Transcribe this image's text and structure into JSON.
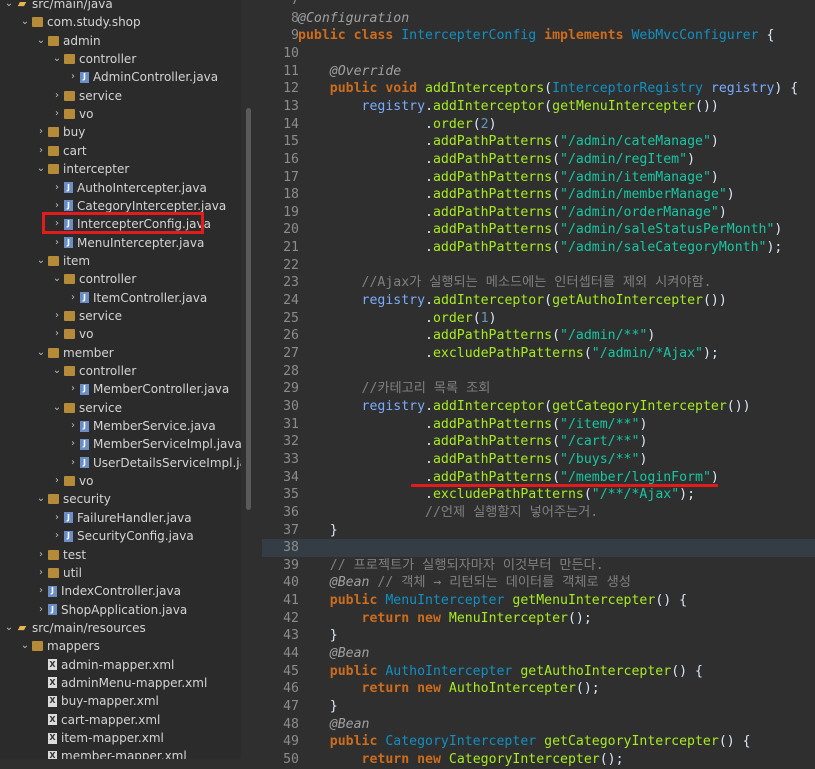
{
  "explorer": {
    "items": [
      {
        "label": "src/main/java",
        "icon": "source-folder-icon",
        "indent": 0,
        "arrow": "v"
      },
      {
        "label": "com.study.shop",
        "icon": "package-icon",
        "indent": 1,
        "arrow": "v"
      },
      {
        "label": "admin",
        "icon": "package-icon",
        "indent": 2,
        "arrow": "v"
      },
      {
        "label": "controller",
        "icon": "package-icon",
        "indent": 3,
        "arrow": "v"
      },
      {
        "label": "AdminController.java",
        "icon": "java-file-icon",
        "indent": 4,
        "arrow": ">"
      },
      {
        "label": "service",
        "icon": "package-icon",
        "indent": 3,
        "arrow": ">"
      },
      {
        "label": "vo",
        "icon": "package-icon",
        "indent": 3,
        "arrow": ">"
      },
      {
        "label": "buy",
        "icon": "package-icon",
        "indent": 2,
        "arrow": ">"
      },
      {
        "label": "cart",
        "icon": "package-icon",
        "indent": 2,
        "arrow": ">"
      },
      {
        "label": "intercepter",
        "icon": "package-icon",
        "indent": 2,
        "arrow": "v"
      },
      {
        "label": "AuthoIntercepter.java",
        "icon": "java-file-icon",
        "indent": 3,
        "arrow": ">"
      },
      {
        "label": "CategoryIntercepter.java",
        "icon": "java-file-icon",
        "indent": 3,
        "arrow": ">"
      },
      {
        "label": "IntercepterConfig.java",
        "icon": "java-file-icon",
        "indent": 3,
        "arrow": ">"
      },
      {
        "label": "MenuIntercepter.java",
        "icon": "java-file-icon",
        "indent": 3,
        "arrow": ">"
      },
      {
        "label": "item",
        "icon": "package-icon",
        "indent": 2,
        "arrow": "v"
      },
      {
        "label": "controller",
        "icon": "package-icon",
        "indent": 3,
        "arrow": "v"
      },
      {
        "label": "ItemController.java",
        "icon": "java-file-icon",
        "indent": 4,
        "arrow": ">"
      },
      {
        "label": "service",
        "icon": "package-icon",
        "indent": 3,
        "arrow": ">"
      },
      {
        "label": "vo",
        "icon": "package-icon",
        "indent": 3,
        "arrow": ">"
      },
      {
        "label": "member",
        "icon": "package-icon",
        "indent": 2,
        "arrow": "v"
      },
      {
        "label": "controller",
        "icon": "package-icon",
        "indent": 3,
        "arrow": "v"
      },
      {
        "label": "MemberController.java",
        "icon": "java-file-icon",
        "indent": 4,
        "arrow": ">"
      },
      {
        "label": "service",
        "icon": "package-icon",
        "indent": 3,
        "arrow": "v"
      },
      {
        "label": "MemberService.java",
        "icon": "java-file-icon",
        "indent": 4,
        "arrow": ">"
      },
      {
        "label": "MemberServiceImpl.java",
        "icon": "java-file-icon",
        "indent": 4,
        "arrow": ">"
      },
      {
        "label": "UserDetailsServiceImpl.java",
        "icon": "java-file-icon",
        "indent": 4,
        "arrow": ">"
      },
      {
        "label": "vo",
        "icon": "package-icon",
        "indent": 3,
        "arrow": ">"
      },
      {
        "label": "security",
        "icon": "package-icon",
        "indent": 2,
        "arrow": "v"
      },
      {
        "label": "FailureHandler.java",
        "icon": "java-file-icon",
        "indent": 3,
        "arrow": ">"
      },
      {
        "label": "SecurityConfig.java",
        "icon": "java-file-icon",
        "indent": 3,
        "arrow": ">"
      },
      {
        "label": "test",
        "icon": "package-icon",
        "indent": 2,
        "arrow": ">"
      },
      {
        "label": "util",
        "icon": "package-icon",
        "indent": 2,
        "arrow": ">"
      },
      {
        "label": "IndexController.java",
        "icon": "java-file-icon",
        "indent": 2,
        "arrow": ">"
      },
      {
        "label": "ShopApplication.java",
        "icon": "java-file-icon",
        "indent": 2,
        "arrow": ">"
      },
      {
        "label": "src/main/resources",
        "icon": "source-folder-icon",
        "indent": 0,
        "arrow": "v"
      },
      {
        "label": "mappers",
        "icon": "package-icon",
        "indent": 1,
        "arrow": "v"
      },
      {
        "label": "admin-mapper.xml",
        "icon": "xml-file-icon",
        "indent": 2,
        "arrow": ""
      },
      {
        "label": "adminMenu-mapper.xml",
        "icon": "xml-file-icon",
        "indent": 2,
        "arrow": ""
      },
      {
        "label": "buy-mapper.xml",
        "icon": "xml-file-icon",
        "indent": 2,
        "arrow": ""
      },
      {
        "label": "cart-mapper.xml",
        "icon": "xml-file-icon",
        "indent": 2,
        "arrow": ""
      },
      {
        "label": "item-mapper.xml",
        "icon": "xml-file-icon",
        "indent": 2,
        "arrow": ""
      },
      {
        "label": "member-mapper.xml",
        "icon": "xml-file-icon",
        "indent": 2,
        "arrow": ""
      }
    ]
  },
  "editor": {
    "lines": [
      {
        "n": "7",
        "tokens": []
      },
      {
        "n": "8",
        "tokens": [
          [
            "ann",
            "@Configuration"
          ]
        ]
      },
      {
        "n": "9",
        "tokens": [
          [
            "kw",
            "public class "
          ],
          [
            "type",
            "IntercepterConfig "
          ],
          [
            "kw",
            "implements "
          ],
          [
            "type",
            "WebMvcConfigurer "
          ],
          [
            "plain",
            "{"
          ]
        ]
      },
      {
        "n": "10",
        "tokens": []
      },
      {
        "n": "11",
        "tokens": [
          [
            "plain",
            "    "
          ],
          [
            "ann",
            "@Override"
          ]
        ]
      },
      {
        "n": "12",
        "tokens": [
          [
            "plain",
            "    "
          ],
          [
            "kw",
            "public void "
          ],
          [
            "meth",
            "addInterceptors"
          ],
          [
            "plain",
            "("
          ],
          [
            "type",
            "InterceptorRegistry "
          ],
          [
            "var",
            "registry"
          ],
          [
            "plain",
            ") {"
          ]
        ]
      },
      {
        "n": "13",
        "tokens": [
          [
            "plain",
            "        "
          ],
          [
            "var",
            "registry"
          ],
          [
            "plain",
            "."
          ],
          [
            "meth",
            "addInterceptor"
          ],
          [
            "plain",
            "("
          ],
          [
            "meth",
            "getMenuIntercepter"
          ],
          [
            "plain",
            "())"
          ]
        ]
      },
      {
        "n": "14",
        "tokens": [
          [
            "plain",
            "                ."
          ],
          [
            "meth",
            "order"
          ],
          [
            "plain",
            "("
          ],
          [
            "num",
            "2"
          ],
          [
            "plain",
            ")"
          ]
        ]
      },
      {
        "n": "15",
        "tokens": [
          [
            "plain",
            "                ."
          ],
          [
            "meth",
            "addPathPatterns"
          ],
          [
            "plain",
            "("
          ],
          [
            "str",
            "\"/admin/cateManage\""
          ],
          [
            "plain",
            ")"
          ]
        ]
      },
      {
        "n": "16",
        "tokens": [
          [
            "plain",
            "                ."
          ],
          [
            "meth",
            "addPathPatterns"
          ],
          [
            "plain",
            "("
          ],
          [
            "str",
            "\"/admin/regItem\""
          ],
          [
            "plain",
            ")"
          ]
        ]
      },
      {
        "n": "17",
        "tokens": [
          [
            "plain",
            "                ."
          ],
          [
            "meth",
            "addPathPatterns"
          ],
          [
            "plain",
            "("
          ],
          [
            "str",
            "\"/admin/itemManage\""
          ],
          [
            "plain",
            ")"
          ]
        ]
      },
      {
        "n": "18",
        "tokens": [
          [
            "plain",
            "                ."
          ],
          [
            "meth",
            "addPathPatterns"
          ],
          [
            "plain",
            "("
          ],
          [
            "str",
            "\"/admin/memberManage\""
          ],
          [
            "plain",
            ")"
          ]
        ]
      },
      {
        "n": "19",
        "tokens": [
          [
            "plain",
            "                ."
          ],
          [
            "meth",
            "addPathPatterns"
          ],
          [
            "plain",
            "("
          ],
          [
            "str",
            "\"/admin/orderManage\""
          ],
          [
            "plain",
            ")"
          ]
        ]
      },
      {
        "n": "20",
        "tokens": [
          [
            "plain",
            "                ."
          ],
          [
            "meth",
            "addPathPatterns"
          ],
          [
            "plain",
            "("
          ],
          [
            "str",
            "\"/admin/saleStatusPerMonth\""
          ],
          [
            "plain",
            ")"
          ]
        ]
      },
      {
        "n": "21",
        "tokens": [
          [
            "plain",
            "                ."
          ],
          [
            "meth",
            "addPathPatterns"
          ],
          [
            "plain",
            "("
          ],
          [
            "str",
            "\"/admin/saleCategoryMonth\""
          ],
          [
            "plain",
            ");"
          ]
        ]
      },
      {
        "n": "22",
        "tokens": []
      },
      {
        "n": "23",
        "tokens": [
          [
            "plain",
            "        "
          ],
          [
            "cmt",
            "//Ajax가 실행되는 메소드에는 인터셉터를 제외 시켜야함."
          ]
        ]
      },
      {
        "n": "24",
        "tokens": [
          [
            "plain",
            "        "
          ],
          [
            "var",
            "registry"
          ],
          [
            "plain",
            "."
          ],
          [
            "meth",
            "addInterceptor"
          ],
          [
            "plain",
            "("
          ],
          [
            "meth",
            "getAuthoIntercepter"
          ],
          [
            "plain",
            "())"
          ]
        ]
      },
      {
        "n": "25",
        "tokens": [
          [
            "plain",
            "                ."
          ],
          [
            "meth",
            "order"
          ],
          [
            "plain",
            "("
          ],
          [
            "num",
            "1"
          ],
          [
            "plain",
            ")"
          ]
        ]
      },
      {
        "n": "26",
        "tokens": [
          [
            "plain",
            "                ."
          ],
          [
            "meth",
            "addPathPatterns"
          ],
          [
            "plain",
            "("
          ],
          [
            "str",
            "\"/admin/**\""
          ],
          [
            "plain",
            ")"
          ]
        ]
      },
      {
        "n": "27",
        "tokens": [
          [
            "plain",
            "                ."
          ],
          [
            "meth",
            "excludePathPatterns"
          ],
          [
            "plain",
            "("
          ],
          [
            "str",
            "\"/admin/*Ajax\""
          ],
          [
            "plain",
            ");"
          ]
        ]
      },
      {
        "n": "28",
        "tokens": []
      },
      {
        "n": "29",
        "tokens": [
          [
            "plain",
            "        "
          ],
          [
            "cmt",
            "//카테고리 목록 조회"
          ]
        ]
      },
      {
        "n": "30",
        "tokens": [
          [
            "plain",
            "        "
          ],
          [
            "var",
            "registry"
          ],
          [
            "plain",
            "."
          ],
          [
            "meth",
            "addInterceptor"
          ],
          [
            "plain",
            "("
          ],
          [
            "meth",
            "getCategoryIntercepter"
          ],
          [
            "plain",
            "())"
          ]
        ]
      },
      {
        "n": "31",
        "tokens": [
          [
            "plain",
            "                ."
          ],
          [
            "meth",
            "addPathPatterns"
          ],
          [
            "plain",
            "("
          ],
          [
            "str",
            "\"/item/**\""
          ],
          [
            "plain",
            ")"
          ]
        ]
      },
      {
        "n": "32",
        "tokens": [
          [
            "plain",
            "                ."
          ],
          [
            "meth",
            "addPathPatterns"
          ],
          [
            "plain",
            "("
          ],
          [
            "str",
            "\"/cart/**\""
          ],
          [
            "plain",
            ")"
          ]
        ]
      },
      {
        "n": "33",
        "tokens": [
          [
            "plain",
            "                ."
          ],
          [
            "meth",
            "addPathPatterns"
          ],
          [
            "plain",
            "("
          ],
          [
            "str",
            "\"/buys/**\""
          ],
          [
            "plain",
            ")"
          ]
        ]
      },
      {
        "n": "34",
        "tokens": [
          [
            "plain",
            "                ."
          ],
          [
            "meth",
            "addPathPatterns"
          ],
          [
            "plain",
            "("
          ],
          [
            "str",
            "\"/member/loginForm\""
          ],
          [
            "plain",
            ")"
          ]
        ]
      },
      {
        "n": "35",
        "tokens": [
          [
            "plain",
            "                ."
          ],
          [
            "meth",
            "excludePathPatterns"
          ],
          [
            "plain",
            "("
          ],
          [
            "str",
            "\"/**/*Ajax\""
          ],
          [
            "plain",
            ");"
          ]
        ]
      },
      {
        "n": "36",
        "tokens": [
          [
            "plain",
            "                "
          ],
          [
            "cmt",
            "//언제 실행할지 넣어주는거."
          ]
        ]
      },
      {
        "n": "37",
        "tokens": [
          [
            "plain",
            "    }"
          ]
        ]
      },
      {
        "n": "38",
        "tokens": []
      },
      {
        "n": "39",
        "tokens": [
          [
            "plain",
            "    "
          ],
          [
            "cmt",
            "// 프로젝트가 실행되자마자 이것부터 만든다."
          ]
        ]
      },
      {
        "n": "40",
        "tokens": [
          [
            "plain",
            "    "
          ],
          [
            "ann",
            "@Bean "
          ],
          [
            "cmt",
            "// 객체 → 리턴되는 데이터를 객체로 생성"
          ]
        ]
      },
      {
        "n": "41",
        "tokens": [
          [
            "plain",
            "    "
          ],
          [
            "kw",
            "public "
          ],
          [
            "type",
            "MenuIntercepter "
          ],
          [
            "meth",
            "getMenuIntercepter"
          ],
          [
            "plain",
            "() {"
          ]
        ]
      },
      {
        "n": "42",
        "tokens": [
          [
            "plain",
            "        "
          ],
          [
            "kw",
            "return new "
          ],
          [
            "meth",
            "MenuIntercepter"
          ],
          [
            "plain",
            "();"
          ]
        ]
      },
      {
        "n": "43",
        "tokens": [
          [
            "plain",
            "    }"
          ]
        ]
      },
      {
        "n": "44",
        "tokens": [
          [
            "plain",
            "    "
          ],
          [
            "ann",
            "@Bean"
          ]
        ]
      },
      {
        "n": "45",
        "tokens": [
          [
            "plain",
            "    "
          ],
          [
            "kw",
            "public "
          ],
          [
            "type",
            "AuthoIntercepter "
          ],
          [
            "meth",
            "getAuthoIntercepter"
          ],
          [
            "plain",
            "() {"
          ]
        ]
      },
      {
        "n": "46",
        "tokens": [
          [
            "plain",
            "        "
          ],
          [
            "kw",
            "return new "
          ],
          [
            "meth",
            "AuthoIntercepter"
          ],
          [
            "plain",
            "();"
          ]
        ]
      },
      {
        "n": "47",
        "tokens": [
          [
            "plain",
            "    }"
          ]
        ]
      },
      {
        "n": "48",
        "tokens": [
          [
            "plain",
            "    "
          ],
          [
            "ann",
            "@Bean"
          ]
        ]
      },
      {
        "n": "49",
        "tokens": [
          [
            "plain",
            "    "
          ],
          [
            "kw",
            "public "
          ],
          [
            "type",
            "CategoryIntercepter "
          ],
          [
            "meth",
            "getCategoryIntercepter"
          ],
          [
            "plain",
            "() {"
          ]
        ]
      },
      {
        "n": "50",
        "tokens": [
          [
            "plain",
            "        "
          ],
          [
            "kw",
            "return new "
          ],
          [
            "meth",
            "CategoryIntercepter"
          ],
          [
            "plain",
            "();"
          ]
        ]
      }
    ]
  },
  "colors": {
    "highlight": "#e11c1c",
    "keyword": "#cc6c1d",
    "string": "#17c6a3",
    "method": "#a7ec21",
    "type": "#1290c3"
  }
}
